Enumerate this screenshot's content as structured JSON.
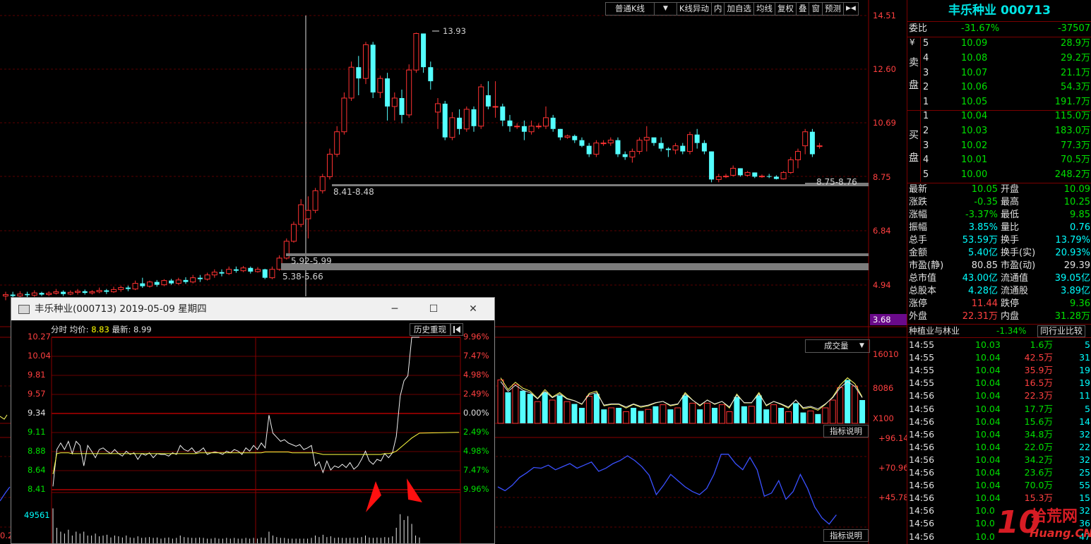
{
  "toolbar": {
    "items": [
      "普通K线",
      "▼",
      "K线异动",
      "内",
      "加自选",
      "均线",
      "复权",
      "叠",
      "窗",
      "预测",
      "▶◀"
    ]
  },
  "kline": {
    "price_axis": [
      "14.51",
      "12.60",
      "10.69",
      "8.75",
      "6.84",
      "4.94",
      "3.68"
    ],
    "annotations": {
      "high": "13.93",
      "zone1": "8.41-8.48",
      "zone2": "8.75-8.76",
      "zone3": "5.92-5.99",
      "zone4": "5.38-5.66"
    },
    "candles": [
      [
        4.55,
        4.6,
        4.4,
        4.7
      ],
      [
        4.6,
        4.55,
        4.45,
        4.7
      ],
      [
        4.55,
        4.62,
        4.5,
        4.72
      ],
      [
        4.62,
        4.58,
        4.5,
        4.7
      ],
      [
        4.58,
        4.66,
        4.52,
        4.75
      ],
      [
        4.66,
        4.6,
        4.55,
        4.7
      ],
      [
        4.6,
        4.65,
        4.55,
        4.72
      ],
      [
        4.65,
        4.7,
        4.6,
        4.8
      ],
      [
        4.7,
        4.62,
        4.55,
        4.75
      ],
      [
        4.62,
        4.68,
        4.58,
        4.75
      ],
      [
        4.68,
        4.72,
        4.6,
        4.8
      ],
      [
        4.72,
        4.66,
        4.6,
        4.78
      ],
      [
        4.66,
        4.7,
        4.6,
        4.76
      ],
      [
        4.7,
        4.75,
        4.65,
        4.85
      ],
      [
        4.75,
        4.7,
        4.62,
        4.8
      ],
      [
        4.7,
        4.78,
        4.66,
        4.88
      ],
      [
        4.78,
        4.85,
        4.7,
        4.92
      ],
      [
        4.85,
        4.8,
        4.72,
        4.92
      ],
      [
        4.8,
        5.0,
        4.76,
        5.1
      ],
      [
        5.0,
        4.9,
        4.84,
        5.2
      ],
      [
        4.9,
        5.05,
        4.85,
        5.1
      ],
      [
        5.05,
        4.95,
        4.88,
        5.12
      ],
      [
        4.95,
        5.1,
        4.9,
        5.15
      ],
      [
        5.1,
        5.0,
        4.95,
        5.16
      ],
      [
        5.0,
        5.12,
        4.95,
        5.2
      ],
      [
        5.12,
        5.05,
        4.98,
        5.22
      ],
      [
        5.05,
        5.2,
        5.0,
        5.3
      ],
      [
        5.2,
        5.15,
        5.05,
        5.3
      ],
      [
        5.15,
        5.3,
        5.1,
        5.38
      ],
      [
        5.3,
        5.4,
        5.2,
        5.5
      ],
      [
        5.4,
        5.35,
        5.25,
        5.5
      ],
      [
        5.35,
        5.5,
        5.3,
        5.6
      ],
      [
        5.5,
        5.45,
        5.38,
        5.6
      ],
      [
        5.45,
        5.55,
        5.4,
        5.62
      ],
      [
        5.55,
        5.42,
        5.35,
        5.6
      ],
      [
        5.42,
        5.5,
        5.38,
        5.58
      ],
      [
        5.5,
        5.2,
        5.15,
        5.52
      ],
      [
        5.2,
        5.5,
        5.15,
        5.6
      ],
      [
        5.5,
        5.9,
        5.45,
        6.0
      ],
      [
        5.9,
        6.5,
        5.85,
        6.6
      ],
      [
        6.5,
        7.1,
        6.45,
        7.2
      ],
      [
        7.1,
        7.8,
        7.0,
        8.0
      ],
      [
        7.3,
        7.6,
        6.6,
        8.1
      ],
      [
        7.6,
        8.3,
        7.5,
        8.4
      ],
      [
        8.3,
        8.8,
        8.2,
        8.9
      ],
      [
        8.8,
        9.6,
        8.7,
        9.8
      ],
      [
        9.6,
        10.4,
        9.5,
        10.6
      ],
      [
        10.4,
        11.6,
        10.3,
        11.8
      ],
      [
        11.6,
        12.7,
        11.5,
        12.9
      ],
      [
        12.7,
        12.3,
        11.7,
        13.1
      ],
      [
        12.3,
        13.5,
        12.1,
        13.6
      ],
      [
        13.5,
        11.8,
        11.6,
        13.6
      ],
      [
        11.8,
        12.3,
        11.6,
        12.4
      ],
      [
        12.3,
        11.3,
        10.8,
        12.5
      ],
      [
        11.3,
        11.6,
        10.8,
        11.8
      ],
      [
        11.6,
        11.0,
        10.7,
        11.9
      ],
      [
        11.0,
        12.6,
        10.9,
        12.8
      ],
      [
        12.6,
        13.9,
        12.5,
        13.93
      ],
      [
        13.9,
        12.7,
        12.5,
        13.9
      ],
      [
        12.7,
        12.2,
        11.9,
        12.9
      ],
      [
        11.1,
        11.4,
        10.5,
        11.6
      ],
      [
        11.4,
        10.2,
        10.1,
        11.5
      ],
      [
        10.2,
        10.9,
        10.1,
        11.1
      ],
      [
        10.9,
        10.5,
        10.3,
        11.2
      ],
      [
        10.5,
        11.2,
        10.4,
        11.3
      ],
      [
        11.2,
        10.6,
        10.4,
        11.3
      ],
      [
        10.6,
        12.0,
        10.5,
        12.1
      ],
      [
        11.7,
        11.3,
        11.2,
        12.2
      ],
      [
        11.3,
        11.3,
        10.9,
        12.2
      ],
      [
        11.3,
        10.8,
        10.6,
        11.4
      ],
      [
        10.8,
        10.6,
        10.4,
        11.0
      ],
      [
        10.6,
        10.6,
        10.5,
        10.7
      ],
      [
        10.6,
        10.4,
        10.1,
        10.8
      ],
      [
        10.4,
        10.6,
        10.3,
        10.8
      ],
      [
        10.6,
        10.6,
        10.5,
        10.7
      ],
      [
        10.6,
        10.9,
        10.5,
        11.3
      ],
      [
        10.9,
        10.5,
        10.4,
        11.0
      ],
      [
        10.5,
        10.2,
        10.1,
        10.5
      ],
      [
        10.2,
        10.25,
        10.15,
        10.3
      ],
      [
        10.25,
        10.1,
        10.0,
        10.3
      ],
      [
        10.1,
        9.9,
        9.85,
        10.2
      ],
      [
        9.9,
        9.6,
        9.5,
        10.0
      ],
      [
        9.6,
        10.0,
        9.5,
        10.1
      ],
      [
        10.0,
        10.0,
        9.9,
        10.1
      ],
      [
        10.0,
        10.1,
        9.9,
        10.2
      ],
      [
        10.1,
        9.6,
        9.5,
        10.2
      ],
      [
        9.6,
        9.5,
        9.4,
        9.7
      ],
      [
        9.5,
        9.7,
        9.3,
        9.8
      ],
      [
        9.7,
        10.1,
        9.6,
        10.2
      ],
      [
        10.1,
        10.2,
        9.7,
        10.6
      ],
      [
        10.2,
        10.0,
        9.9,
        10.1
      ],
      [
        10.0,
        9.8,
        9.7,
        10.2
      ],
      [
        9.8,
        9.75,
        9.5,
        9.85
      ],
      [
        9.75,
        9.9,
        9.6,
        10.0
      ],
      [
        9.9,
        9.7,
        9.6,
        10.0
      ],
      [
        9.7,
        10.3,
        9.6,
        10.4
      ],
      [
        10.3,
        10.0,
        9.8,
        10.5
      ],
      [
        10.0,
        9.7,
        9.6,
        10.1
      ],
      [
        9.7,
        8.7,
        8.6,
        9.7
      ],
      [
        8.7,
        8.8,
        8.6,
        8.9
      ],
      [
        8.8,
        8.82,
        8.75,
        8.9
      ],
      [
        8.85,
        9.1,
        8.8,
        9.2
      ],
      [
        9.1,
        8.85,
        8.8,
        9.1
      ],
      [
        8.85,
        8.95,
        8.8,
        9.0
      ],
      [
        8.95,
        8.8,
        8.75,
        8.95
      ],
      [
        8.8,
        8.82,
        8.76,
        8.88
      ],
      [
        8.82,
        8.8,
        8.75,
        8.9
      ],
      [
        8.8,
        8.72,
        8.7,
        8.85
      ],
      [
        8.72,
        8.95,
        8.7,
        9.0
      ],
      [
        8.95,
        9.4,
        8.9,
        9.5
      ],
      [
        9.4,
        9.7,
        9.1,
        9.8
      ],
      [
        9.9,
        10.4,
        9.6,
        10.5
      ],
      [
        10.4,
        9.6,
        9.5,
        10.5
      ],
      [
        9.9,
        9.9,
        9.8,
        10.0
      ]
    ]
  },
  "volume_panel": {
    "selector": "成交量",
    "selector_arrow": "▼",
    "axis": [
      "16010",
      "8086",
      "X100"
    ],
    "bars": [
      0.56,
      0.4,
      0.5,
      0.42,
      0.38,
      0.28,
      0.4,
      0.3,
      0.36,
      0.28,
      0.25,
      0.2,
      0.35,
      0.38,
      0.18,
      0.2,
      0.2,
      0.15,
      0.2,
      0.16,
      0.18,
      0.22,
      0.24,
      0.18,
      0.2,
      0.36,
      0.26,
      0.18,
      0.26,
      0.2,
      0.24,
      0.15,
      0.34,
      0.22,
      0.22,
      0.36,
      0.18,
      0.24,
      0.2,
      0.15,
      0.26,
      0.14,
      0.16,
      0.12,
      0.2,
      0.3,
      0.46,
      0.56,
      0.48,
      0.3
    ],
    "bar_up": [
      1,
      0,
      1,
      0,
      0,
      1,
      0,
      1,
      0,
      1,
      0,
      0,
      1,
      0,
      0,
      1,
      0,
      1,
      0,
      0,
      1,
      0,
      1,
      0,
      1,
      0,
      1,
      0,
      1,
      0,
      1,
      1,
      0,
      0,
      1,
      0,
      0,
      1,
      0,
      1,
      0,
      0,
      1,
      0,
      1,
      1,
      1,
      0,
      1,
      0
    ],
    "button": "指标说明"
  },
  "indicator_panel": {
    "axis": [
      "+96.14",
      "+70.96",
      "+45.78"
    ],
    "line": [
      0.5,
      0.45,
      0.52,
      0.62,
      0.68,
      0.75,
      0.74,
      0.78,
      0.72,
      0.76,
      0.8,
      0.74,
      0.78,
      0.82,
      0.7,
      0.74,
      0.8,
      0.84,
      0.9,
      0.84,
      0.76,
      0.65,
      0.4,
      0.52,
      0.66,
      0.58,
      0.5,
      0.44,
      0.4,
      0.48,
      0.66,
      0.92,
      0.92,
      0.8,
      0.72,
      0.88,
      0.72,
      0.38,
      0.42,
      0.58,
      0.34,
      0.44,
      0.66,
      0.48,
      0.24,
      0.1,
      0.02,
      0.14
    ],
    "button": "指标说明"
  },
  "quote_panel": {
    "title": "丰乐种业 000713",
    "weibi": {
      "label": "委比",
      "pct": "-31.67%",
      "val": "-37507"
    },
    "sell_label_top": "¥",
    "sell_label": [
      "卖",
      "盘"
    ],
    "buy_label": [
      "买",
      "盘"
    ],
    "sell": [
      {
        "n": "5",
        "price": "10.09",
        "vol": "28.9万"
      },
      {
        "n": "4",
        "price": "10.08",
        "vol": "29.2万"
      },
      {
        "n": "3",
        "price": "10.07",
        "vol": "21.1万"
      },
      {
        "n": "2",
        "price": "10.06",
        "vol": "54.3万"
      },
      {
        "n": "1",
        "price": "10.05",
        "vol": "191.7万"
      }
    ],
    "buy": [
      {
        "n": "1",
        "price": "10.04",
        "vol": "115.0万"
      },
      {
        "n": "2",
        "price": "10.03",
        "vol": "183.0万"
      },
      {
        "n": "3",
        "price": "10.02",
        "vol": "77.3万"
      },
      {
        "n": "4",
        "price": "10.01",
        "vol": "70.5万"
      },
      {
        "n": "5",
        "price": "10.00",
        "vol": "248.2万"
      }
    ],
    "stats": [
      {
        "l1": "最新",
        "v1": "10.05",
        "c1": "green",
        "l2": "开盘",
        "v2": "10.09",
        "c2": "green"
      },
      {
        "l1": "涨跌",
        "v1": "-0.35",
        "c1": "green",
        "l2": "最高",
        "v2": "10.25",
        "c2": "green"
      },
      {
        "l1": "涨幅",
        "v1": "-3.37%",
        "c1": "green",
        "l2": "最低",
        "v2": "9.85",
        "c2": "green"
      },
      {
        "l1": "振幅",
        "v1": "3.85%",
        "c1": "cyan",
        "l2": "量比",
        "v2": "0.76",
        "c2": "cyan"
      },
      {
        "l1": "总手",
        "v1": "53.59万",
        "c1": "cyan",
        "l2": "换手",
        "v2": "13.79%",
        "c2": "cyan"
      },
      {
        "l1": "金额",
        "v1": "5.40亿",
        "c1": "cyan",
        "l2": "换手(实)",
        "v2": "20.93%",
        "c2": "cyan"
      },
      {
        "l1": "市盈(静)",
        "v1": "80.85",
        "c1": "white",
        "l2": "市盈(动)",
        "v2": "29.39",
        "c2": "white"
      },
      {
        "l1": "总市值",
        "v1": "43.00亿",
        "c1": "cyan",
        "l2": "流通值",
        "v2": "39.05亿",
        "c2": "cyan"
      },
      {
        "l1": "总股本",
        "v1": "4.28亿",
        "c1": "cyan",
        "l2": "流通股",
        "v2": "3.89亿",
        "c2": "cyan"
      },
      {
        "l1": "涨停",
        "v1": "11.44",
        "c1": "red",
        "l2": "跌停",
        "v2": "9.36",
        "c2": "green"
      },
      {
        "l1": "外盘",
        "v1": "22.31万",
        "c1": "red",
        "l2": "内盘",
        "v2": "31.28万",
        "c2": "green"
      }
    ],
    "sector": {
      "name": "种植业与林业",
      "pct": "-1.34%",
      "button": "同行业比较"
    },
    "ticks": [
      {
        "t": "14:55",
        "p": "10.03",
        "v": "1.6万",
        "vc": "green",
        "n": "5"
      },
      {
        "t": "14:55",
        "p": "10.04",
        "v": "42.5万",
        "vc": "red",
        "n": "31"
      },
      {
        "t": "14:55",
        "p": "10.04",
        "v": "35.9万",
        "vc": "red",
        "n": "19"
      },
      {
        "t": "14:55",
        "p": "10.04",
        "v": "16.5万",
        "vc": "red",
        "n": "19"
      },
      {
        "t": "14:56",
        "p": "10.04",
        "v": "22.3万",
        "vc": "red",
        "n": "11"
      },
      {
        "t": "14:56",
        "p": "10.04",
        "v": "17.7万",
        "vc": "green",
        "n": "5"
      },
      {
        "t": "14:56",
        "p": "10.04",
        "v": "15.6万",
        "vc": "green",
        "n": "14"
      },
      {
        "t": "14:56",
        "p": "10.04",
        "v": "34.8万",
        "vc": "green",
        "n": "32"
      },
      {
        "t": "14:56",
        "p": "10.04",
        "v": "22.0万",
        "vc": "green",
        "n": "22"
      },
      {
        "t": "14:56",
        "p": "10.04",
        "v": "34.2万",
        "vc": "green",
        "n": "32"
      },
      {
        "t": "14:56",
        "p": "10.04",
        "v": "23.6万",
        "vc": "green",
        "n": "25"
      },
      {
        "t": "14:56",
        "p": "10.04",
        "v": "70.0万",
        "vc": "green",
        "n": "55"
      },
      {
        "t": "14:56",
        "p": "10.04",
        "v": "15.3万",
        "vc": "red",
        "n": "15"
      },
      {
        "t": "14:56",
        "p": "10.0",
        "v": "",
        "vc": "green",
        "n": "32"
      },
      {
        "t": "14:56",
        "p": "10.0",
        "v": "",
        "vc": "green",
        "n": "36"
      },
      {
        "t": "14:56",
        "p": "10.0",
        "v": "",
        "vc": "green",
        "n": "47"
      }
    ]
  },
  "popup": {
    "title": "丰乐种业(000713) 2019-05-09 星期四",
    "btn_min": "─",
    "btn_max": "☐",
    "btn_close": "✕",
    "header_label": "分时",
    "avg_label": "均价:",
    "avg_value": "8.83",
    "latest_label": "最新:",
    "latest_value": "8.99",
    "replay_button": "历史重现",
    "left_axis": [
      "10.27",
      "10.04",
      "9.81",
      "9.57",
      "9.34",
      "9.11",
      "8.88",
      "8.64",
      "8.41"
    ],
    "right_axis": [
      "9.96%",
      "7.47%",
      "4.98%",
      "2.49%",
      "0.00%",
      "2.49%",
      "4.98%",
      "7.47%",
      "9.96%"
    ],
    "volume_label": "49561",
    "price_line": [
      8.45,
      8.9,
      8.98,
      8.9,
      9.0,
      8.85,
      9.0,
      8.95,
      8.7,
      8.95,
      8.88,
      8.8,
      8.9,
      8.92,
      8.88,
      8.85,
      8.9,
      8.85,
      8.82,
      8.88,
      8.84,
      8.86,
      8.78,
      8.85,
      8.83,
      8.86,
      8.8,
      8.85,
      8.84,
      8.84,
      8.82,
      8.86,
      8.84,
      8.95,
      8.9,
      8.88,
      8.92,
      8.86,
      8.88,
      8.92,
      8.84,
      8.86,
      8.87,
      8.86,
      8.84,
      8.88,
      8.86,
      8.9,
      8.88,
      8.84,
      8.92,
      8.88,
      8.95,
      8.9,
      8.98,
      8.92,
      9.32,
      9.1,
      9.05,
      9.0,
      9.02,
      8.98,
      8.96,
      8.94,
      8.96,
      8.9,
      8.92,
      8.95,
      8.7,
      8.75,
      8.62,
      8.76,
      8.65,
      8.7,
      8.68,
      8.72,
      8.68,
      8.74,
      8.66,
      8.7,
      8.78,
      8.88,
      8.76,
      8.72,
      8.78,
      8.76,
      8.85,
      8.8,
      8.86,
      9.06,
      9.55,
      9.74,
      9.8,
      10.27,
      10.27,
      10.27
    ],
    "avg_line": [
      8.6,
      8.85,
      8.86,
      8.86,
      8.86,
      8.85,
      8.85,
      8.85,
      8.85,
      8.85,
      8.85,
      8.85,
      8.85,
      8.85,
      8.85,
      8.85,
      8.85,
      8.85,
      8.85,
      8.85,
      8.85,
      8.85,
      8.85,
      8.85,
      8.85,
      8.85,
      8.85,
      8.85,
      8.85,
      8.85,
      8.85,
      8.85,
      8.85,
      8.85,
      8.85,
      8.85,
      8.85,
      8.85,
      8.86,
      8.86,
      8.86,
      8.86,
      8.86,
      8.86,
      8.86,
      8.86,
      8.86,
      8.86,
      8.86,
      8.86,
      8.86,
      8.86,
      8.86,
      8.86,
      8.86,
      8.87,
      8.87,
      8.87,
      8.87,
      8.87,
      8.87,
      8.87,
      8.86,
      8.86,
      8.86,
      8.86,
      8.86,
      8.86,
      8.86,
      8.85,
      8.84,
      8.84,
      8.84,
      8.84,
      8.84,
      8.84,
      8.84,
      8.84,
      8.84,
      8.84,
      8.84,
      8.84,
      8.84,
      8.84,
      8.84,
      8.84,
      8.85,
      8.85,
      8.86,
      8.88,
      8.92,
      8.96,
      9.0,
      9.04,
      9.07,
      9.1
    ],
    "vol_bars": [
      0.9,
      0.4,
      0.3,
      0.25,
      0.35,
      0.2,
      0.3,
      0.25,
      0.3,
      0.2,
      0.2,
      0.25,
      0.18,
      0.2,
      0.22,
      0.15,
      0.2,
      0.18,
      0.15,
      0.2,
      0.15,
      0.14,
      0.18,
      0.14,
      0.15,
      0.16,
      0.14,
      0.15,
      0.12,
      0.14,
      0.15,
      0.12,
      0.14,
      0.2,
      0.16,
      0.15,
      0.14,
      0.14,
      0.15,
      0.14,
      0.12,
      0.12,
      0.14,
      0.12,
      0.12,
      0.14,
      0.12,
      0.14,
      0.12,
      0.12,
      0.14,
      0.12,
      0.14,
      0.12,
      0.15,
      0.14,
      0.3,
      0.2,
      0.16,
      0.14,
      0.14,
      0.12,
      0.12,
      0.12,
      0.12,
      0.12,
      0.12,
      0.14,
      0.2,
      0.16,
      0.22,
      0.16,
      0.18,
      0.14,
      0.15,
      0.14,
      0.14,
      0.14,
      0.15,
      0.14,
      0.16,
      0.2,
      0.15,
      0.14,
      0.15,
      0.14,
      0.16,
      0.15,
      0.18,
      0.4,
      0.75,
      0.6,
      0.7,
      0.5,
      0.2,
      0.15
    ]
  },
  "watermark": {
    "top": "拾荒网",
    "bottom": "Huang.CN",
    "digit": "10"
  },
  "misc": {
    "left_edge_label": "0.2"
  }
}
